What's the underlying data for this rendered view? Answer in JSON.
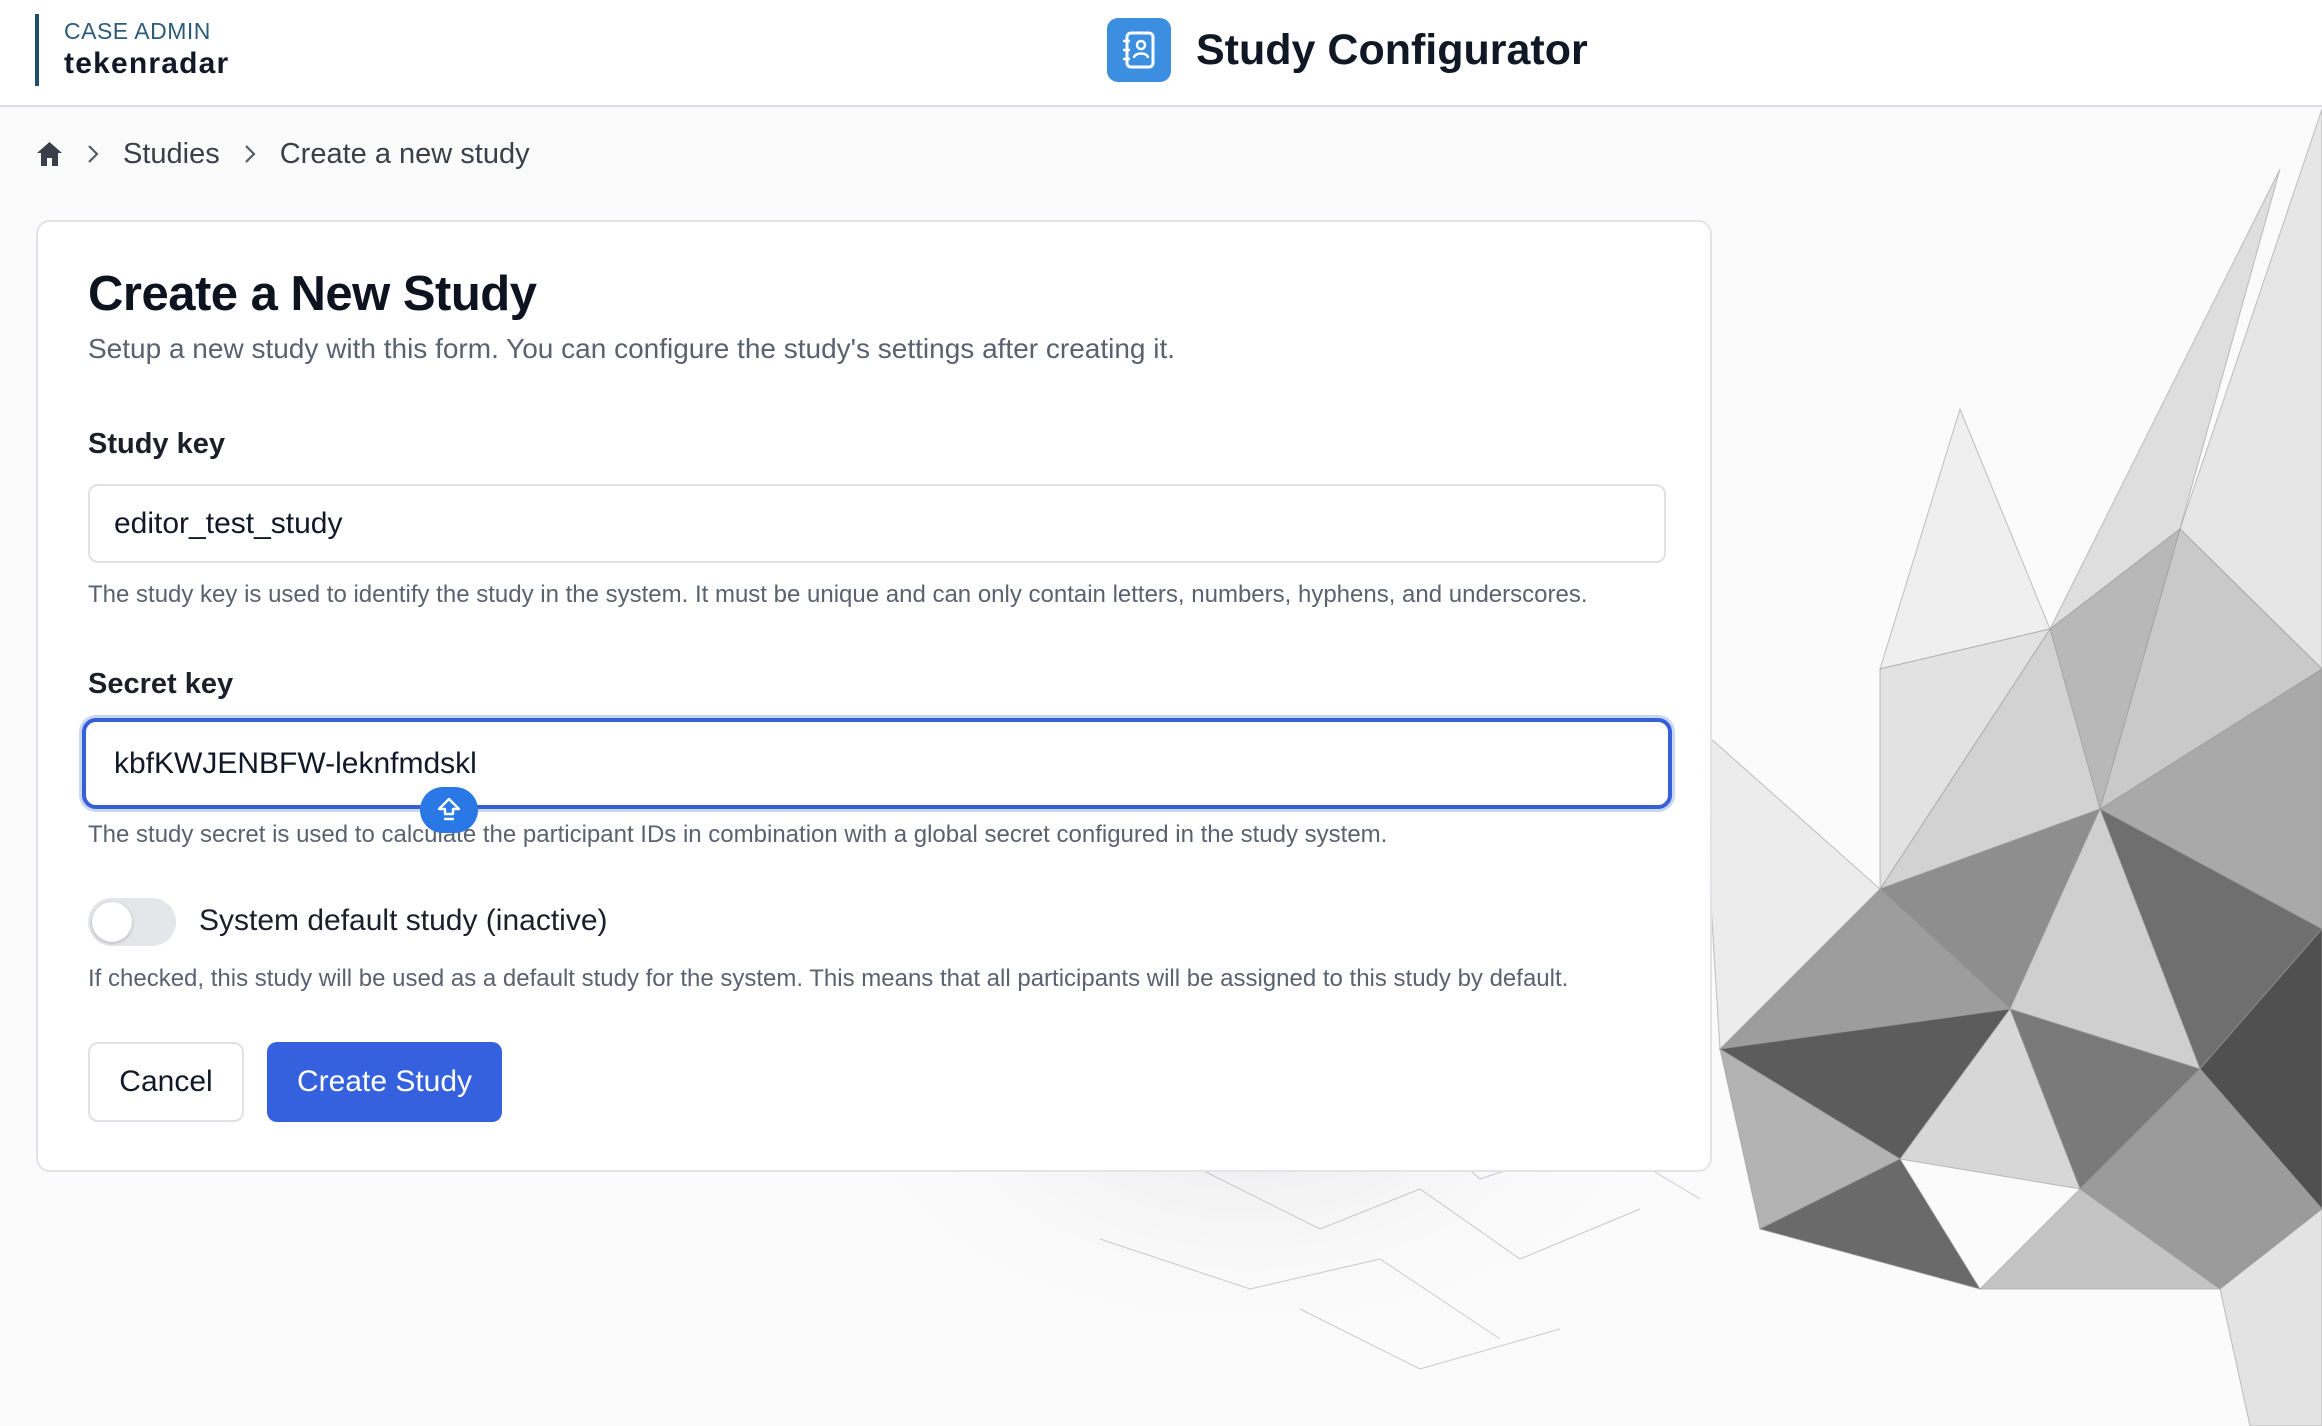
{
  "header": {
    "org_label": "CASE ADMIN",
    "org_name": "tekenradar",
    "app_title": "Study Configurator"
  },
  "breadcrumb": {
    "items": [
      "Studies",
      "Create a new study"
    ]
  },
  "form": {
    "title": "Create a New Study",
    "subtitle": "Setup a new study with this form. You can configure the study's settings after creating it.",
    "study_key": {
      "label": "Study key",
      "value": "editor_test_study",
      "help": "The study key is used to identify the study in the system. It must be unique and can only contain letters, numbers, hyphens, and underscores."
    },
    "secret_key": {
      "label": "Secret key",
      "value": "kbfKWJENBFW-leknfmdskl",
      "help": "The study secret is used to calculate the participant IDs in combination with a global secret configured in the study system."
    },
    "default_study": {
      "label": "System default study (inactive)",
      "checked": false,
      "help": "If checked, this study will be used as a default study for the system. This means that all participants will be assigned to this study by default."
    },
    "buttons": {
      "cancel": "Cancel",
      "create": "Create Study"
    }
  },
  "colors": {
    "primary": "#3561de",
    "focus_ring": "#3560d8",
    "app_icon": "#3c8ee0",
    "brand_bar": "#1f4e6b"
  }
}
